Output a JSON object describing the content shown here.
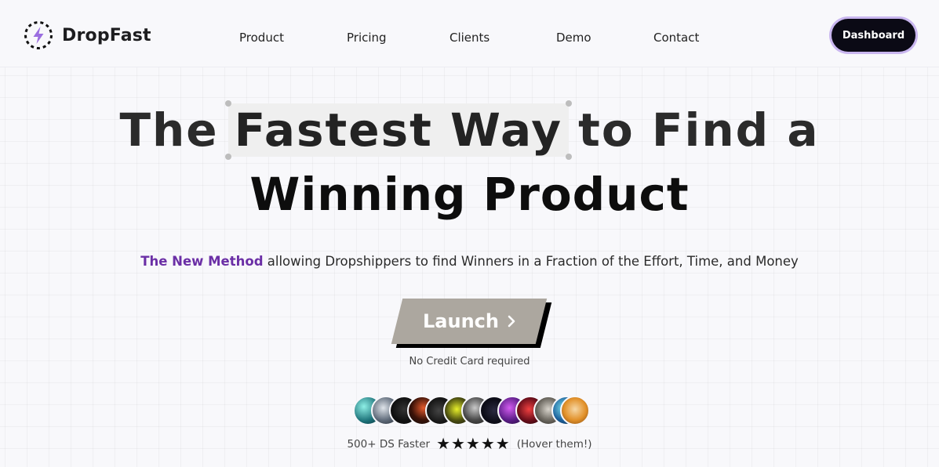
{
  "header": {
    "brand": "DropFast",
    "nav": [
      "Product",
      "Pricing",
      "Clients",
      "Demo",
      "Contact"
    ],
    "dashboard_label": "Dashboard"
  },
  "hero": {
    "line1_before": "The",
    "line1_highlight": "Fastest Way",
    "line1_after": "to Find a",
    "line2": "Winning Product",
    "subtitle_accent": "The New Method",
    "subtitle_rest": " allowing Dropshippers to find Winners in a Fraction of the Effort, Time, and Money",
    "launch_label": "Launch",
    "launch_icon": "chevron-right-icon",
    "no_credit": "No Credit Card required"
  },
  "social_proof": {
    "avatar_count": 12,
    "label": "500+ DS Faster",
    "stars": "★★★★★",
    "rating": 5,
    "hint": "(Hover them!)"
  },
  "colors": {
    "accent": "#6b2fa6",
    "dashboard_bg": "#0b0a15",
    "dashboard_ring": "#c9b6ef",
    "launch_bg": "#aca79f",
    "bolt_icon": "#9b6ee0"
  }
}
